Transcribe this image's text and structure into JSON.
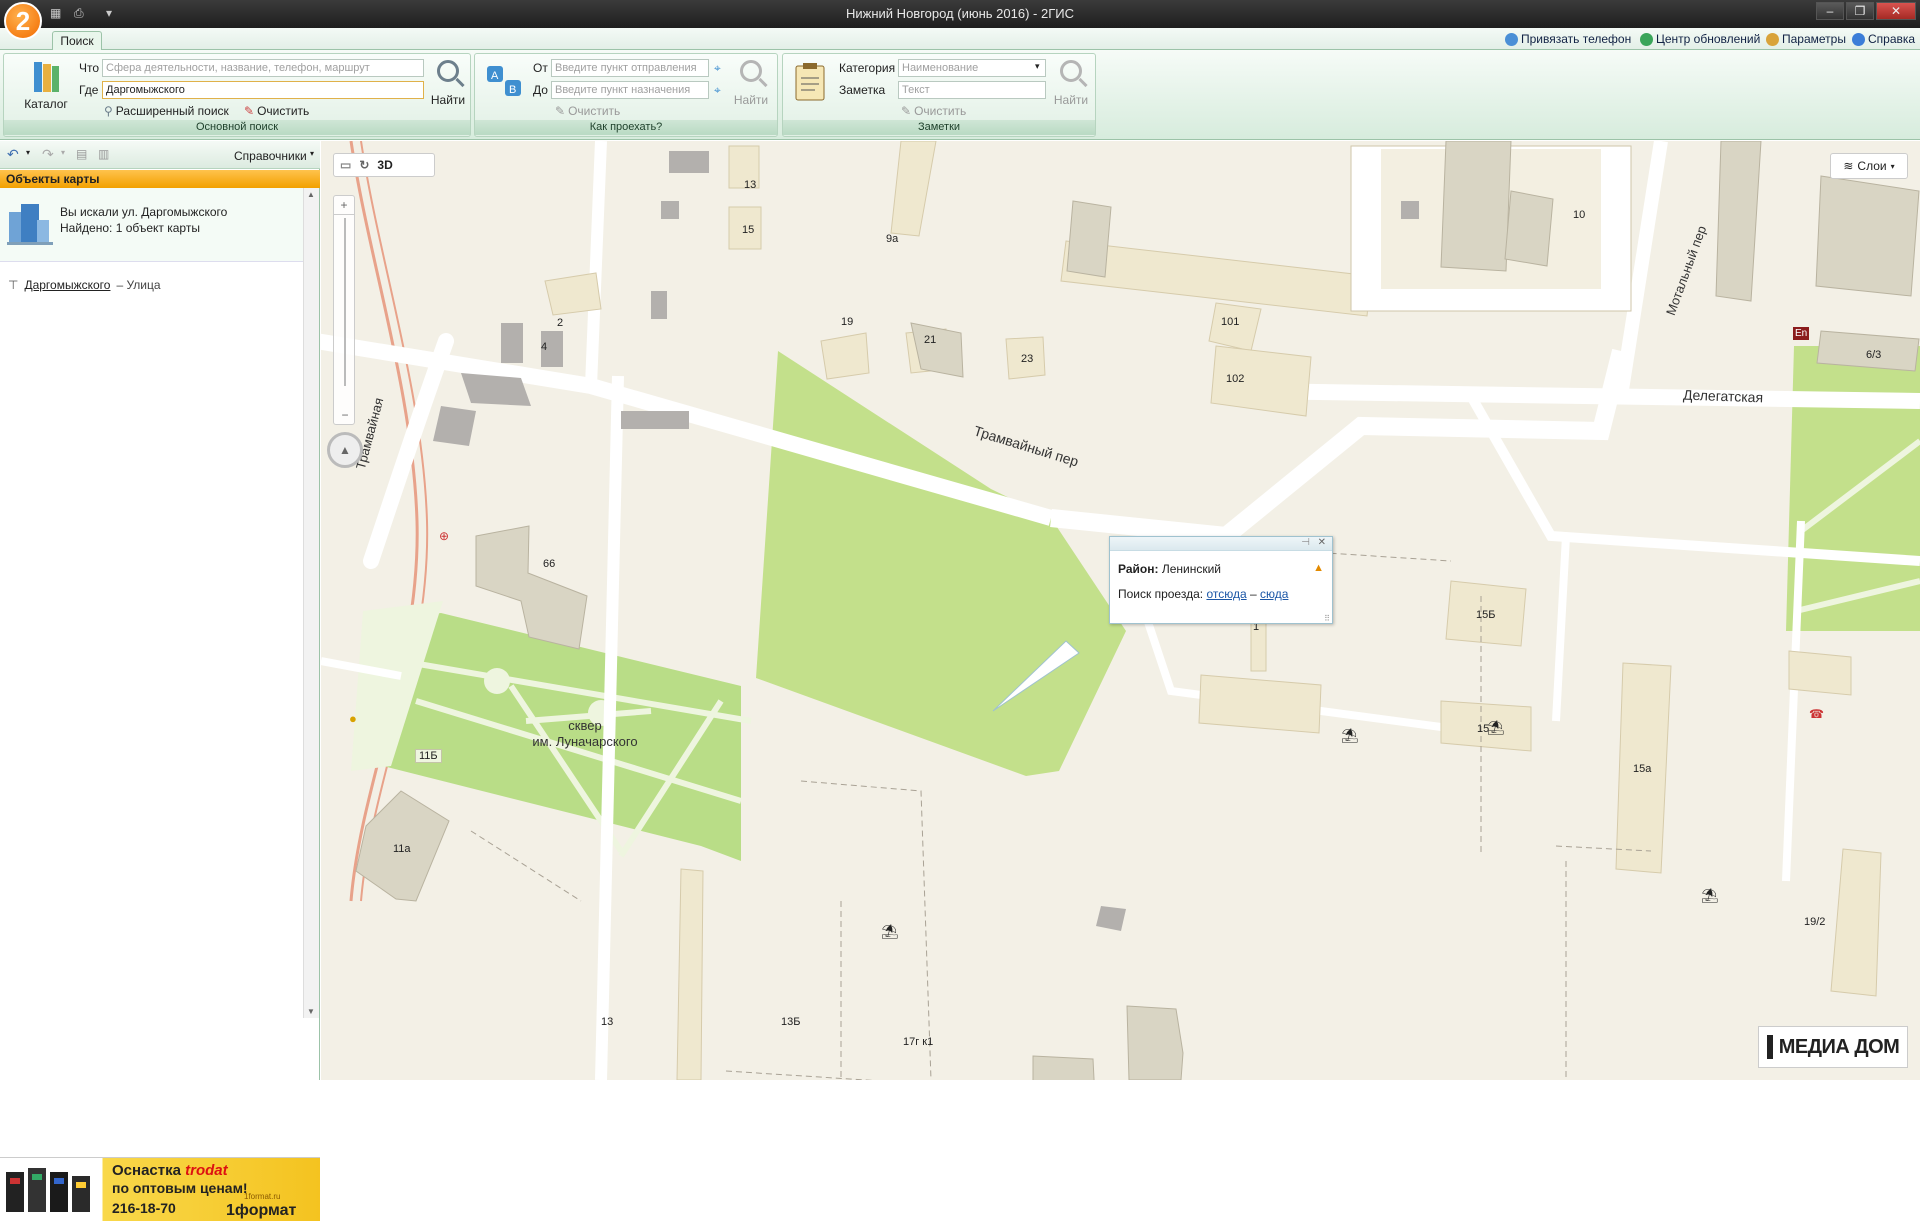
{
  "window": {
    "title": "Нижний Новгород (июнь 2016) - 2ГИС",
    "logo_text": "2",
    "controls": [
      "–",
      "❐",
      "✕"
    ]
  },
  "tabs": [
    {
      "label": "Поиск",
      "active": true
    }
  ],
  "top_links": {
    "bind_phone": "Привязать телефон",
    "updates": "Центр обновлений",
    "settings": "Параметры",
    "help": "Справка"
  },
  "ribbon": {
    "main_search": {
      "catalog": "Каталог",
      "what_label": "Что",
      "what_placeholder": "Сфера деятельности, название, телефон, маршрут",
      "where_label": "Где",
      "where_value": "Даргомыжского",
      "find": "Найти",
      "advanced": "Расширенный поиск",
      "clear": "Очистить",
      "group_label": "Основной поиск"
    },
    "route": {
      "from_label": "От",
      "from_placeholder": "Введите пункт отправления",
      "to_label": "До",
      "to_placeholder": "Введите пункт назначения",
      "find": "Найти",
      "clear": "Очистить",
      "group_label": "Как проехать?"
    },
    "notes": {
      "category_label": "Категория",
      "category_placeholder": "Наименование",
      "note_label": "Заметка",
      "note_placeholder": "Текст",
      "find": "Найти",
      "clear": "Очистить",
      "group_label": "Заметки"
    }
  },
  "sidebar": {
    "directories": "Справочники",
    "header": "Объекты карты",
    "searched": "Вы искали ул. Даргомыжского",
    "found": "Найдено: 1 объект карты",
    "result_name": "Даргомыжского",
    "result_type": "– Улица"
  },
  "ad": {
    "line1": "Оснастка",
    "brand": "trodat",
    "line2": "по оптовым ценам!",
    "phone": "216-18-70",
    "logo": "1формат",
    "site": "1format.ru"
  },
  "map": {
    "tool_3d": "3D",
    "layers": "Слои",
    "streets": {
      "tramvaynaya": "Трамвайная",
      "tramvayny_per": "Трамвайный пер",
      "delegatskaya": "Делегатская",
      "motalny_per": "Мотальный пер"
    },
    "park_label_1": "сквер",
    "park_label_2": "им. Луначарского",
    "buildings": [
      "13",
      "15",
      "9а",
      "2",
      "4",
      "101",
      "10",
      "6/3",
      "19",
      "21",
      "23",
      "102",
      "66",
      "15Б",
      "1",
      "15а",
      "15",
      "11Б",
      "11а",
      "13",
      "13Б",
      "17г к1",
      "19/2",
      "En"
    ],
    "popup": {
      "district_label": "Район:",
      "district": "Ленинский",
      "route_label": "Поиск проезда:",
      "from_here": "отсюда",
      "dash": "–",
      "to_here": "сюда"
    },
    "media_logo": "МЕДИА ДОМ"
  }
}
